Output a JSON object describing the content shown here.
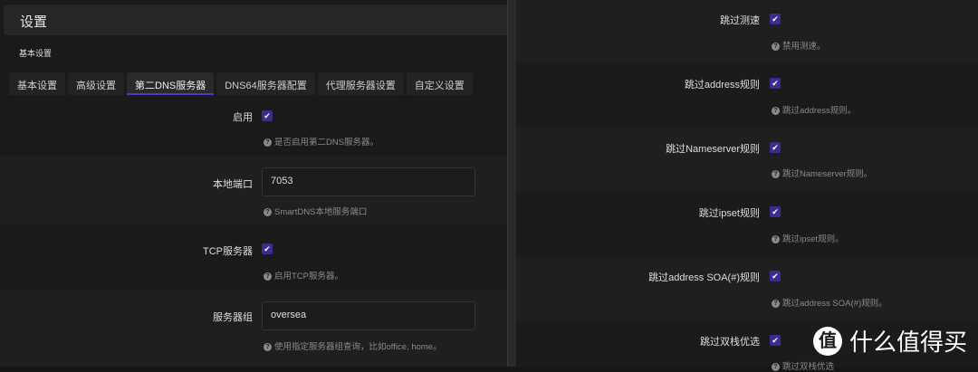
{
  "header": {
    "title": "设置",
    "section": "基本设置"
  },
  "tabs": [
    {
      "label": "基本设置"
    },
    {
      "label": "高级设置"
    },
    {
      "label": "第二DNS服务器",
      "active": true
    },
    {
      "label": "DNS64服务器配置"
    },
    {
      "label": "代理服务器设置"
    },
    {
      "label": "自定义设置"
    }
  ],
  "left_fields": [
    {
      "label": "启用",
      "type": "checkbox",
      "checked": true,
      "hint": "是否启用第二DNS服务器。"
    },
    {
      "label": "本地端口",
      "type": "text",
      "value": "7053",
      "hint": "SmartDNS本地服务端口"
    },
    {
      "label": "TCP服务器",
      "type": "checkbox",
      "checked": true,
      "hint": "启用TCP服务器。"
    },
    {
      "label": "服务器组",
      "type": "text",
      "value": "oversea",
      "hint": "使用指定服务器组查询，比如office, home。"
    }
  ],
  "right_fields": [
    {
      "label": "跳过测速",
      "checked": true,
      "hint": "禁用测速。"
    },
    {
      "label": "跳过address规则",
      "checked": true,
      "hint": "跳过address规则。"
    },
    {
      "label": "跳过Nameserver规则",
      "checked": true,
      "hint": "跳过Nameserver规则。"
    },
    {
      "label": "跳过ipset规则",
      "checked": true,
      "hint": "跳过ipset规则。"
    },
    {
      "label": "跳过address SOA(#)规则",
      "checked": true,
      "hint": "跳过address SOA(#)规则。"
    },
    {
      "label": "跳过双栈优选",
      "checked": true,
      "hint": "跳过双栈优选"
    }
  ],
  "watermark": {
    "mark": "值",
    "text": "什么值得买"
  },
  "icons": {
    "check": "✔",
    "help": "?"
  },
  "colors": {
    "accent": "#3a2d8f"
  }
}
